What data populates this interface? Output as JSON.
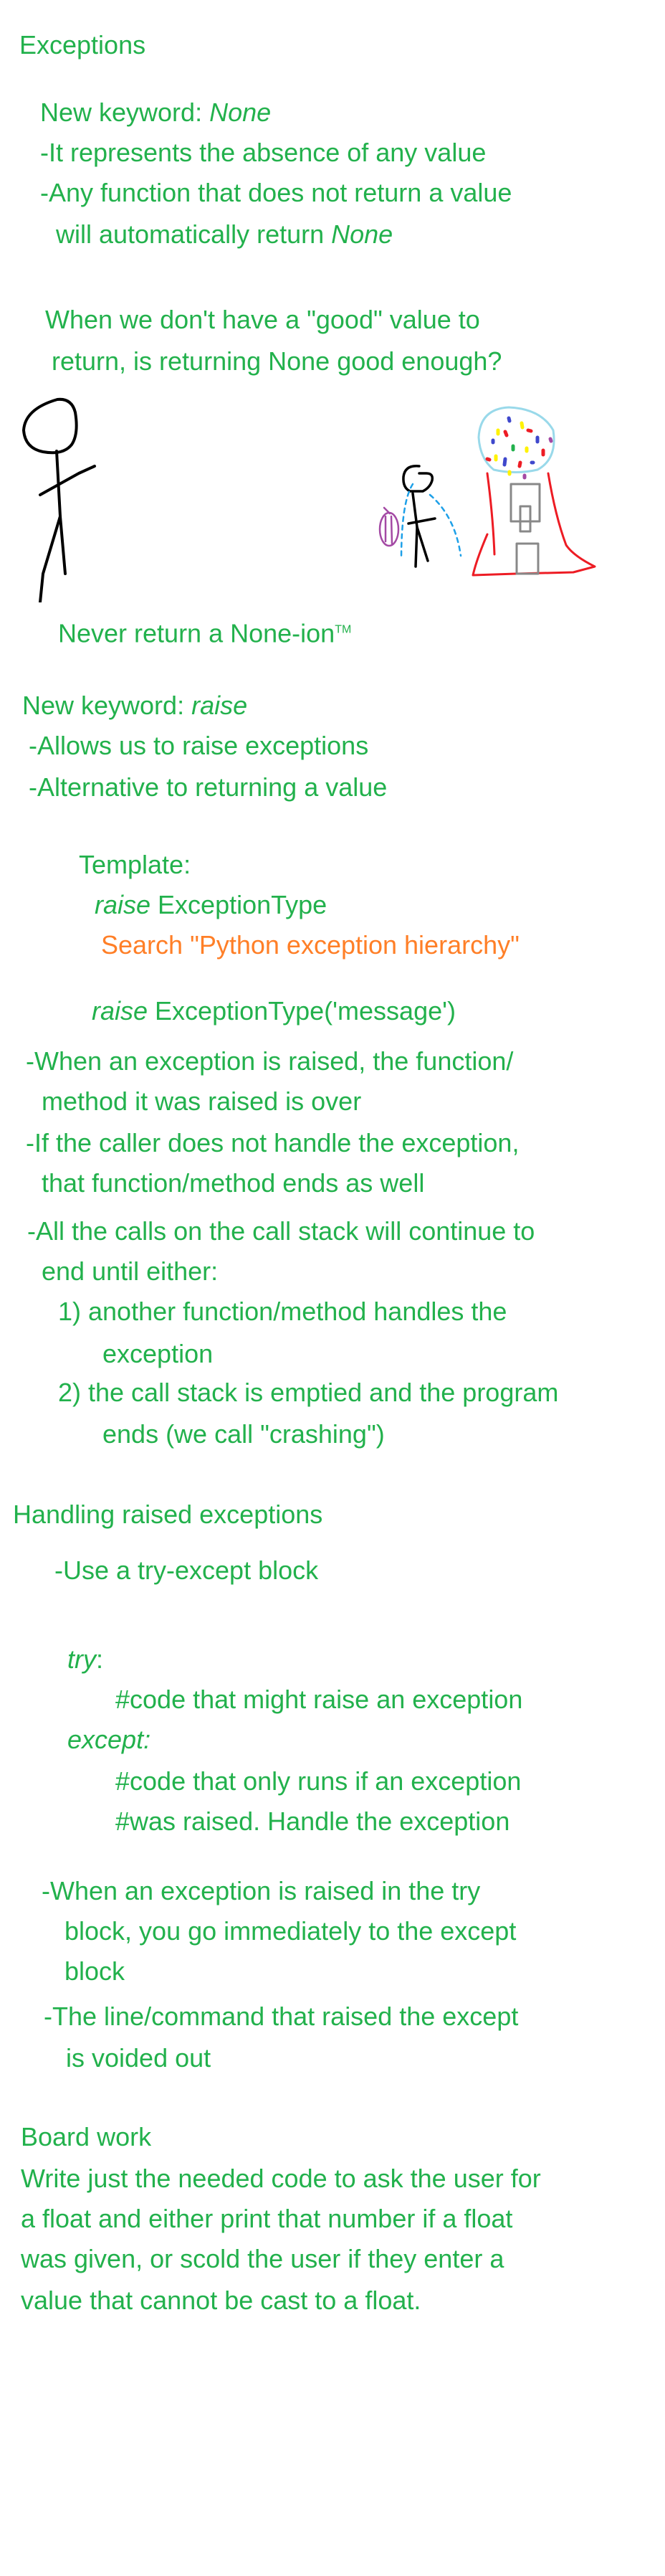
{
  "colors": {
    "text": "#22b14c",
    "highlight": "#ff7f27"
  },
  "s1": {
    "title": "Exceptions",
    "kw_prefix": "New keyword: ",
    "kw": "None",
    "b1": "-It represents the absence of any value",
    "b2": "-Any function that does not return a value",
    "b3_prefix": "will automatically return ",
    "b3_kw": "None",
    "q1": "When we don't have a \"good\" value to",
    "q2": "return, is returning None good enough?",
    "joke": "Never return a None-ion",
    "tm": "TM"
  },
  "s2": {
    "kw_prefix": "New keyword: ",
    "kw": "raise",
    "b1": "-Allows us to raise exceptions",
    "b2": "-Alternative to returning a value",
    "template": "Template:",
    "t1_kw": "raise",
    "t1": " ExceptionType",
    "search": "Search \"Python exception hierarchy\"",
    "t2_kw": "raise",
    "t2": " ExceptionType('message')",
    "p1a": "-When an exception is raised, the function/",
    "p1b": "method it was raised is over",
    "p2a": "-If the caller does not handle the exception,",
    "p2b": "that function/method ends as well",
    "p3a": "-All the calls on the call stack will continue to",
    "p3b": "end until either:",
    "o1a": "1) another function/method handles the",
    "o1b": "exception",
    "o2a": "2) the call stack is emptied and the program",
    "o2b": "ends (we call \"crashing\")"
  },
  "s3": {
    "title": "Handling raised exceptions",
    "b1": "-Use a try-except block",
    "try": "try",
    ":": ":",
    "c1": "#code that might raise an exception",
    "except": "except:",
    "c2": "#code that only runs if an exception",
    "c3": "#was raised. Handle the exception",
    "p1a": "-When an exception is raised in the try",
    "p1b": "block, you go immediately to the except",
    "p1c": "block",
    "p2a": "-The line/command that raised the except",
    "p2b": "is voided out"
  },
  "s4": {
    "title": "Board work",
    "l1": "Write just the needed code to ask the user for",
    "l2": "a float and either print that number if a float",
    "l3": "was given, or scold the user if they enter a",
    "l4": "value that cannot be cast to a float."
  }
}
